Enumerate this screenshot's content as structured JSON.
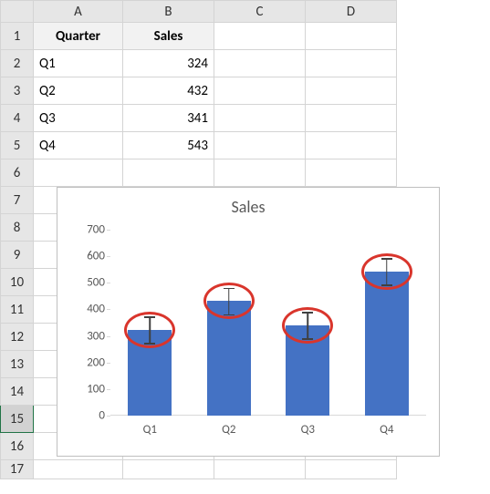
{
  "columns": [
    "A",
    "B",
    "C",
    "D"
  ],
  "rows": [
    "1",
    "2",
    "3",
    "4",
    "5",
    "6",
    "7",
    "8",
    "9",
    "10",
    "11",
    "12",
    "13",
    "14",
    "15",
    "16",
    "17"
  ],
  "selected_row": "15",
  "table": {
    "headers": {
      "quarter": "Quarter",
      "sales": "Sales"
    },
    "data": [
      {
        "quarter": "Q1",
        "sales": "324"
      },
      {
        "quarter": "Q2",
        "sales": "432"
      },
      {
        "quarter": "Q3",
        "sales": "341"
      },
      {
        "quarter": "Q4",
        "sales": "543"
      }
    ]
  },
  "chart_data": {
    "type": "bar",
    "title": "Sales",
    "categories": [
      "Q1",
      "Q2",
      "Q3",
      "Q4"
    ],
    "values": [
      324,
      432,
      341,
      543
    ],
    "error_bars": {
      "type": "standard",
      "amount": 50
    },
    "ylim": [
      0,
      700
    ],
    "ystep": 100,
    "yticks": [
      "0",
      "100",
      "200",
      "300",
      "400",
      "500",
      "600",
      "700"
    ],
    "xlabel": "",
    "ylabel": "",
    "annotations": "red ellipses around each error-bar cap"
  }
}
